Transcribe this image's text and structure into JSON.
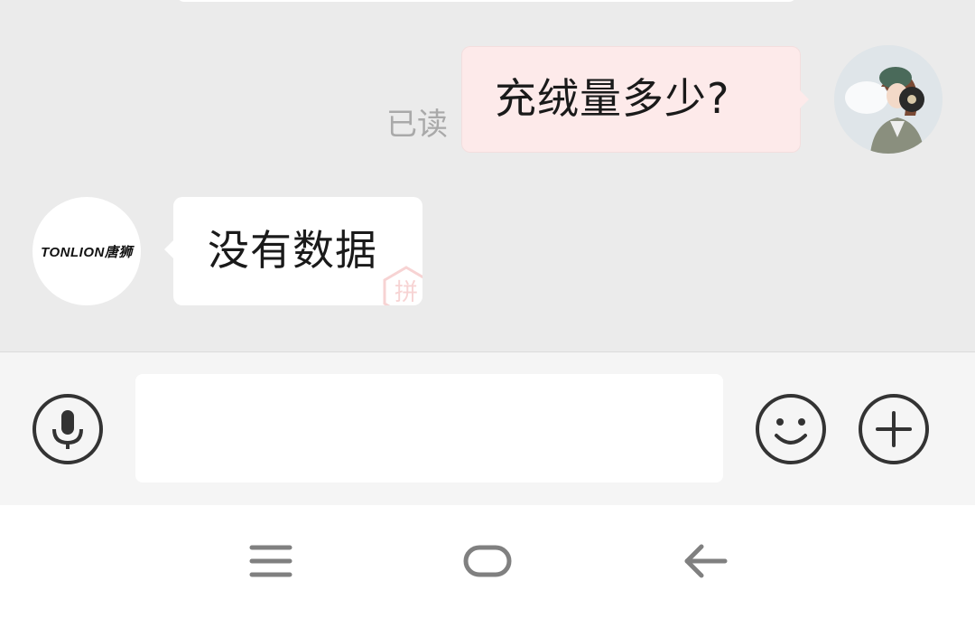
{
  "chat": {
    "outgoing_message": "充绒量多少?",
    "read_status": "已读",
    "incoming_message": "没有数据",
    "contact_logo_text": "TONLION唐狮",
    "watermark_glyph": "拼"
  },
  "input_bar": {
    "text_value": "",
    "icons": [
      "microphone-icon",
      "emoji-icon",
      "plus-icon"
    ]
  },
  "nav_bar": {
    "icons": [
      "menu-icon",
      "home-icon",
      "back-icon"
    ]
  },
  "colors": {
    "chat_background": "#ebebeb",
    "outgoing_bubble": "#fdeaea",
    "incoming_bubble": "#ffffff",
    "read_status_text": "#a9a9a9",
    "icon_stroke": "#333333",
    "nav_icon": "#808080"
  }
}
